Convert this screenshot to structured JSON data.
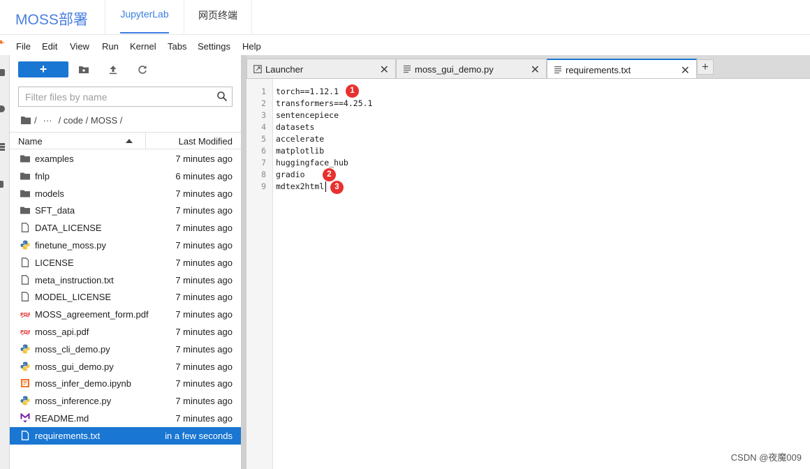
{
  "header": {
    "brand": "MOSS部署",
    "tabs": [
      {
        "label": "JupyterLab",
        "active": true
      },
      {
        "label": "网页终端",
        "active": false
      }
    ]
  },
  "menu": [
    "File",
    "Edit",
    "View",
    "Run",
    "Kernel",
    "Tabs",
    "Settings",
    "Help"
  ],
  "file_browser": {
    "new_label": "+",
    "filter_placeholder": "Filter files by name",
    "breadcrumb": {
      "root": "/",
      "ellipsis": "···",
      "path": "/ code / MOSS /"
    },
    "columns": {
      "name": "Name",
      "modified": "Last Modified"
    },
    "files": [
      {
        "name": "examples",
        "modified": "7 minutes ago",
        "icon": "folder-icon"
      },
      {
        "name": "fnlp",
        "modified": "6 minutes ago",
        "icon": "folder-icon"
      },
      {
        "name": "models",
        "modified": "7 minutes ago",
        "icon": "folder-icon"
      },
      {
        "name": "SFT_data",
        "modified": "7 minutes ago",
        "icon": "folder-icon"
      },
      {
        "name": "DATA_LICENSE",
        "modified": "7 minutes ago",
        "icon": "file-icon"
      },
      {
        "name": "finetune_moss.py",
        "modified": "7 minutes ago",
        "icon": "python-icon"
      },
      {
        "name": "LICENSE",
        "modified": "7 minutes ago",
        "icon": "file-icon"
      },
      {
        "name": "meta_instruction.txt",
        "modified": "7 minutes ago",
        "icon": "text-file-icon"
      },
      {
        "name": "MODEL_LICENSE",
        "modified": "7 minutes ago",
        "icon": "file-icon"
      },
      {
        "name": "MOSS_agreement_form.pdf",
        "modified": "7 minutes ago",
        "icon": "pdf-icon"
      },
      {
        "name": "moss_api.pdf",
        "modified": "7 minutes ago",
        "icon": "pdf-icon"
      },
      {
        "name": "moss_cli_demo.py",
        "modified": "7 minutes ago",
        "icon": "python-icon"
      },
      {
        "name": "moss_gui_demo.py",
        "modified": "7 minutes ago",
        "icon": "python-icon"
      },
      {
        "name": "moss_infer_demo.ipynb",
        "modified": "7 minutes ago",
        "icon": "notebook-icon"
      },
      {
        "name": "moss_inference.py",
        "modified": "7 minutes ago",
        "icon": "python-icon"
      },
      {
        "name": "README.md",
        "modified": "7 minutes ago",
        "icon": "markdown-icon"
      },
      {
        "name": "requirements.txt",
        "modified": "in a few seconds",
        "icon": "text-file-icon",
        "selected": true
      }
    ]
  },
  "editor_tabs": [
    {
      "label": "Launcher",
      "icon": "launcher-icon",
      "active": false
    },
    {
      "label": "moss_gui_demo.py",
      "icon": "text-file-icon",
      "active": false
    },
    {
      "label": "requirements.txt",
      "icon": "text-file-icon",
      "active": true
    }
  ],
  "add_tab_label": "+",
  "editor": {
    "lines": [
      "torch==1.12.1",
      "transformers==4.25.1",
      "sentencepiece",
      "datasets",
      "accelerate",
      "matplotlib",
      "huggingface_hub",
      "gradio",
      "mdtex2html"
    ],
    "badges": [
      "1",
      "2",
      "3"
    ]
  },
  "watermark": "CSDN @夜魔009"
}
